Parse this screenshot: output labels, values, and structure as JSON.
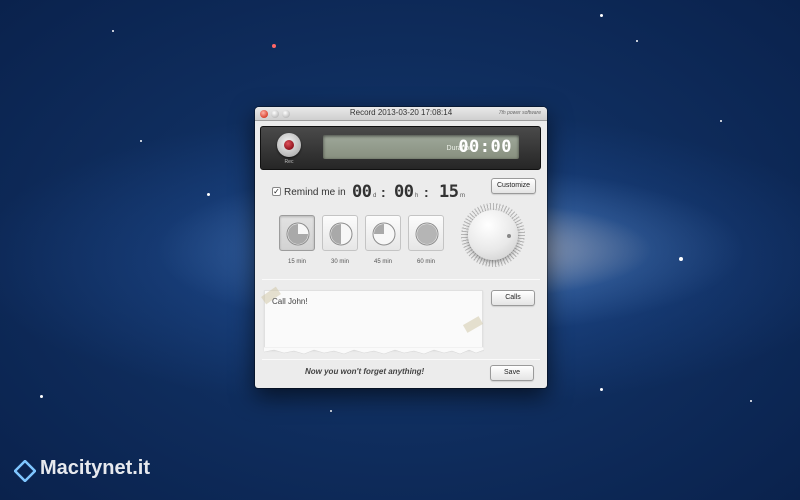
{
  "window": {
    "title": "Record 2013-03-20 17:08:14",
    "brand": "7th  power  software"
  },
  "recorder": {
    "rec_label": "Rec",
    "duration_label": "Duration",
    "duration_value": "00:00"
  },
  "reminder": {
    "checked": true,
    "check_mark": "✓",
    "label": "Remind me in",
    "days": "00",
    "days_unit": "d",
    "hours": "00",
    "hours_unit": "h",
    "minutes": "15",
    "minutes_unit": "m",
    "customize_label": "Customize"
  },
  "presets": [
    {
      "label": "15 min",
      "fraction": 0.25,
      "active": true
    },
    {
      "label": "30 min",
      "fraction": 0.5,
      "active": false
    },
    {
      "label": "45 min",
      "fraction": 0.75,
      "active": false
    },
    {
      "label": "60 min",
      "fraction": 1.0,
      "active": false
    }
  ],
  "note": {
    "text": "Call John!",
    "calls_label": "Calls"
  },
  "footer": {
    "tagline": "Now you won't forget anything!",
    "save_label": "Save"
  },
  "watermark": {
    "text": "Macitynet.it"
  }
}
